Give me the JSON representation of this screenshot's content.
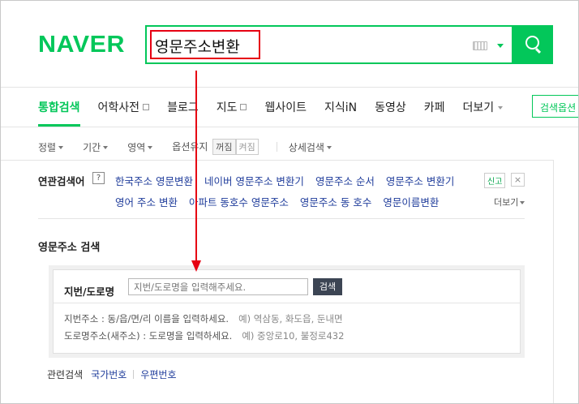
{
  "header": {
    "logo": "NAVER",
    "query": "영문주소변환"
  },
  "tabs": [
    {
      "label": "통합검색",
      "active": true
    },
    {
      "label": "어학사전"
    },
    {
      "label": "블로그"
    },
    {
      "label": "지도"
    },
    {
      "label": "웹사이트"
    },
    {
      "label": "지식iN"
    },
    {
      "label": "동영상"
    },
    {
      "label": "카페"
    },
    {
      "label": "더보기"
    }
  ],
  "search_option_label": "검색옵션",
  "filters": {
    "sort": "정렬",
    "period": "기간",
    "area": "영역",
    "keep_option": "옵션유지",
    "toggle_on": "꺼짐",
    "toggle_off": "켜짐",
    "detail_search": "상세검색"
  },
  "related": {
    "title": "연관검색어",
    "help": "?",
    "row1": [
      "한국주소 영문변환",
      "네이버 영문주소 변환기",
      "영문주소 순서",
      "영문주소 변환기"
    ],
    "row2": [
      "영어 주소 변환",
      "아파트 동호수 영문주소",
      "영문주소 동 호수",
      "영문이름변환"
    ],
    "report": "신고",
    "more": "더보기"
  },
  "address_search": {
    "title": "영문주소 검색",
    "label": "지번/도로명",
    "placeholder": "지번/도로명을 입력해주세요.",
    "button": "검색",
    "hint1": "지번주소 : 동/읍/면/리 이름을 입력하세요.",
    "example1": "예) 역삼동, 화도읍, 둔내면",
    "hint2": "도로명주소(새주소) : 도로명을 입력하세요.",
    "example2": "예) 중앙로10, 불정로432"
  },
  "footer": {
    "label": "관련검색",
    "links": [
      "국가번호",
      "우편번호"
    ]
  },
  "colors": {
    "brand": "#03c75a",
    "annotation": "#e60012",
    "link": "#1f3c9b"
  }
}
